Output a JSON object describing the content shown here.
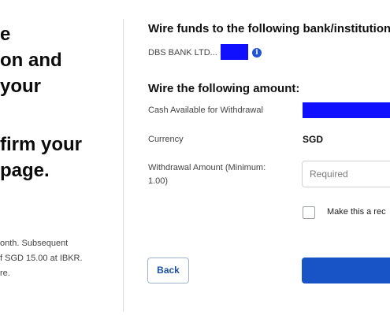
{
  "left_panel": {
    "lines": [
      "e",
      "on and",
      "your",
      "firm your",
      "page."
    ],
    "notes": [
      "onth. Subsequent",
      "f SGD 15.00 at IBKR.",
      "re."
    ]
  },
  "wire_to": {
    "heading": "Wire funds to the following bank/institution:",
    "bank_name": "DBS BANK LTD..."
  },
  "amount_section": {
    "heading": "Wire the following amount:",
    "cash_available_label": "Cash Available for Withdrawal",
    "currency_label": "Currency",
    "currency_value": "SGD",
    "withdrawal_label_line1": "Withdrawal Amount (Minimum:",
    "withdrawal_label_line2": "1.00)",
    "withdrawal_placeholder": "Required",
    "checkbox_label": "Make this a rec"
  },
  "buttons": {
    "back_label": "Back"
  },
  "colors": {
    "redaction": "#1010ff",
    "primary": "#1854c5",
    "info_icon": "#1f55d6"
  }
}
